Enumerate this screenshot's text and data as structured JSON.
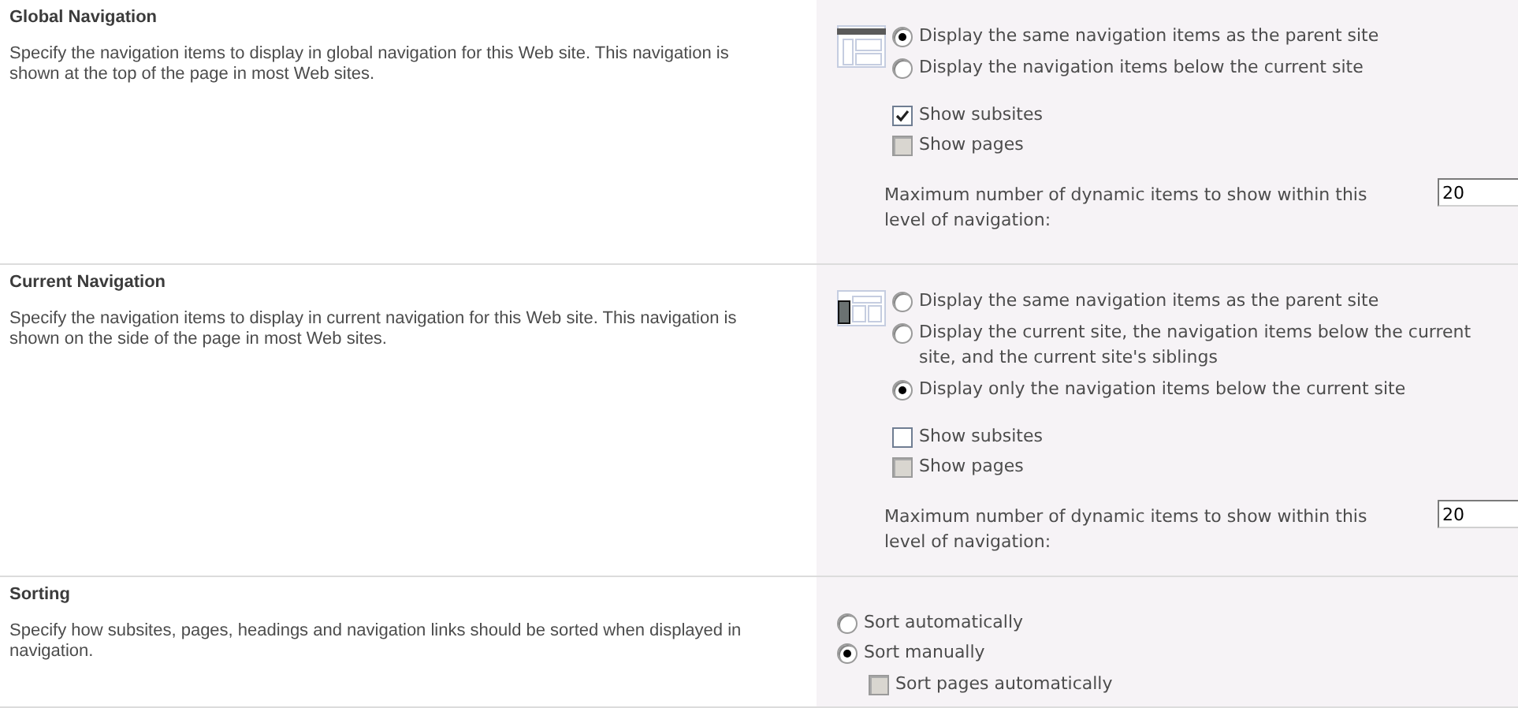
{
  "sections": [
    {
      "title": "Global Navigation",
      "description": "Specify the navigation items to display in global navigation for this Web site. This navigation is shown at the top of the page in most Web sites.",
      "radios": [
        {
          "label": "Display the same navigation items as the parent site",
          "selected": true
        },
        {
          "label": "Display the navigation items below the current site",
          "selected": false
        }
      ],
      "checkboxes": [
        {
          "label": "Show subsites",
          "checked": true,
          "disabled": false
        },
        {
          "label": "Show pages",
          "checked": false,
          "disabled": true
        }
      ],
      "max_items": {
        "label": "Maximum number of dynamic items to show within this level of navigation:",
        "value": "20"
      }
    },
    {
      "title": "Current Navigation",
      "description": "Specify the navigation items to display in current navigation for this Web site. This navigation is shown on the side of the page in most Web sites.",
      "radios": [
        {
          "label": "Display the same navigation items as the parent site",
          "selected": false
        },
        {
          "label": "Display the current site, the navigation items below the current site, and the current site's siblings",
          "selected": false
        },
        {
          "label": "Display only the navigation items below the current site",
          "selected": true
        }
      ],
      "checkboxes": [
        {
          "label": "Show subsites",
          "checked": false,
          "disabled": false
        },
        {
          "label": "Show pages",
          "checked": false,
          "disabled": true
        }
      ],
      "max_items": {
        "label": "Maximum number of dynamic items to show within this level of navigation:",
        "value": "20"
      }
    },
    {
      "title": "Sorting",
      "description": "Specify how subsites, pages, headings and navigation links should be sorted when displayed in navigation.",
      "radios": [
        {
          "label": "Sort automatically",
          "selected": false
        },
        {
          "label": "Sort manually",
          "selected": true,
          "children": [
            {
              "label": "Sort pages automatically",
              "checked": false,
              "disabled": true
            }
          ]
        }
      ]
    }
  ]
}
